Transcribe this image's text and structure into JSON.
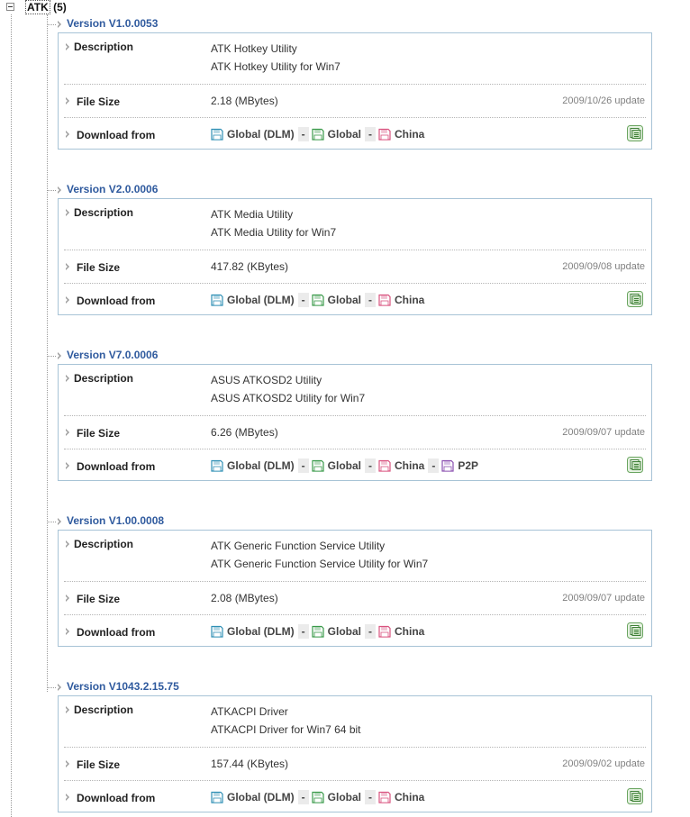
{
  "tree": {
    "root_name": "ATK",
    "root_count": "(5)"
  },
  "labels": {
    "description": "Description",
    "file_size": "File Size",
    "download_from": "Download from",
    "separator": "-"
  },
  "mirror_colors": {
    "global_dlm": "#2f8fb5",
    "global": "#3a9a4a",
    "china": "#d9537f",
    "p2p": "#8a4fb0"
  },
  "versions": [
    {
      "title": "Version V1.0.0053",
      "description_line1": "ATK Hotkey Utility",
      "description_line2": "ATK Hotkey Utility for Win7",
      "file_size": "2.18 (MBytes)",
      "update": "2009/10/26 update",
      "mirrors": [
        "Global (DLM)",
        "Global",
        "China"
      ]
    },
    {
      "title": "Version V2.0.0006",
      "description_line1": "ATK Media Utility",
      "description_line2": "ATK Media Utility for Win7",
      "file_size": "417.82 (KBytes)",
      "update": "2009/09/08 update",
      "mirrors": [
        "Global (DLM)",
        "Global",
        "China"
      ]
    },
    {
      "title": "Version V7.0.0006",
      "description_line1": "ASUS ATKOSD2 Utility",
      "description_line2": "ASUS ATKOSD2 Utility for Win7",
      "file_size": "6.26 (MBytes)",
      "update": "2009/09/07 update",
      "mirrors": [
        "Global (DLM)",
        "Global",
        "China",
        "P2P"
      ]
    },
    {
      "title": "Version V1.00.0008",
      "description_line1": "ATK Generic Function Service Utility",
      "description_line2": "ATK Generic Function Service Utility for Win7",
      "file_size": "2.08 (MBytes)",
      "update": "2009/09/07 update",
      "mirrors": [
        "Global (DLM)",
        "Global",
        "China"
      ]
    },
    {
      "title": "Version V1043.2.15.75",
      "description_line1": "ATKACPI Driver",
      "description_line2": "ATKACPI Driver for Win7 64 bit",
      "file_size": "157.44 (KBytes)",
      "update": "2009/09/02 update",
      "mirrors": [
        "Global (DLM)",
        "Global",
        "China"
      ]
    }
  ],
  "icons": {
    "expand_toggle": "collapse-minus-icon",
    "bullet": "arrow-bullet-icon",
    "mirror": "floppy-disk-icon",
    "multi_download": "multi-page-download-icon"
  }
}
